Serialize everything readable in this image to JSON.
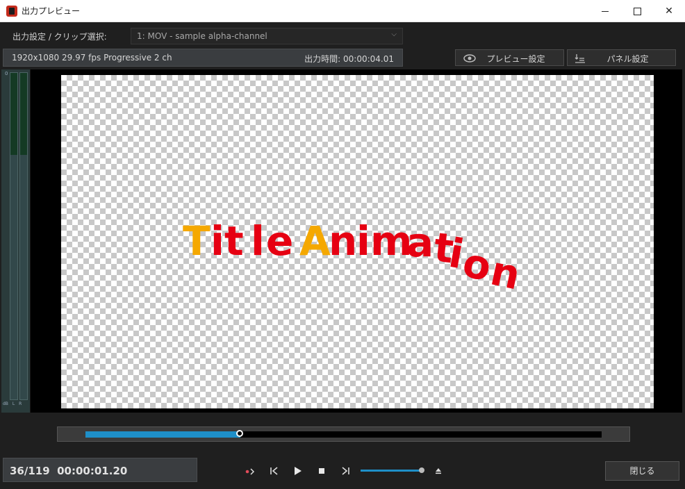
{
  "window": {
    "title": "出力プレビュー",
    "accent_color": "#c42b1c"
  },
  "settings": {
    "clip_label": "出力設定 / クリップ選択:",
    "clip_value": "1: MOV - sample alpha-channel",
    "format_info": "1920x1080 29.97 fps Progressive 2 ch",
    "output_time": "出力時間: 00:00:04.01",
    "preview_settings_label": "プレビュー設定",
    "panel_settings_label": "パネル設定"
  },
  "meter": {
    "top_label": "0",
    "db_label": "dB",
    "left_label": "L",
    "right_label": "R"
  },
  "preview": {
    "title_letters": [
      {
        "char": "T",
        "color": "#f5a800"
      },
      {
        "char": "i",
        "color": "#e60012"
      },
      {
        "char": "t",
        "color": "#e60012"
      },
      {
        "char": "l",
        "color": "#e60012"
      },
      {
        "char": "e",
        "color": "#e60012"
      },
      {
        "char": "A",
        "color": "#f5a800"
      },
      {
        "char": "n",
        "color": "#e60012"
      },
      {
        "char": "i",
        "color": "#e60012"
      },
      {
        "char": "m",
        "color": "#e60012"
      },
      {
        "char": "a",
        "color": "#e60012"
      },
      {
        "char": "t",
        "color": "#e60012"
      },
      {
        "char": "i",
        "color": "#e60012"
      },
      {
        "char": "o",
        "color": "#e60012"
      },
      {
        "char": "n",
        "color": "#e60012"
      }
    ]
  },
  "playback": {
    "current_frame": "36/119",
    "current_time": "00:00:01.20",
    "progress": 0.3,
    "volume": 0.95,
    "seek_color": "#1e8fc8",
    "close_label": "閉じる"
  },
  "icons": {
    "record": "record-icon",
    "prev": "skip-previous-icon",
    "play": "play-icon",
    "stop": "stop-icon",
    "next": "skip-next-icon",
    "eject": "eject-icon",
    "eye": "eye-icon",
    "download": "download-icon"
  }
}
